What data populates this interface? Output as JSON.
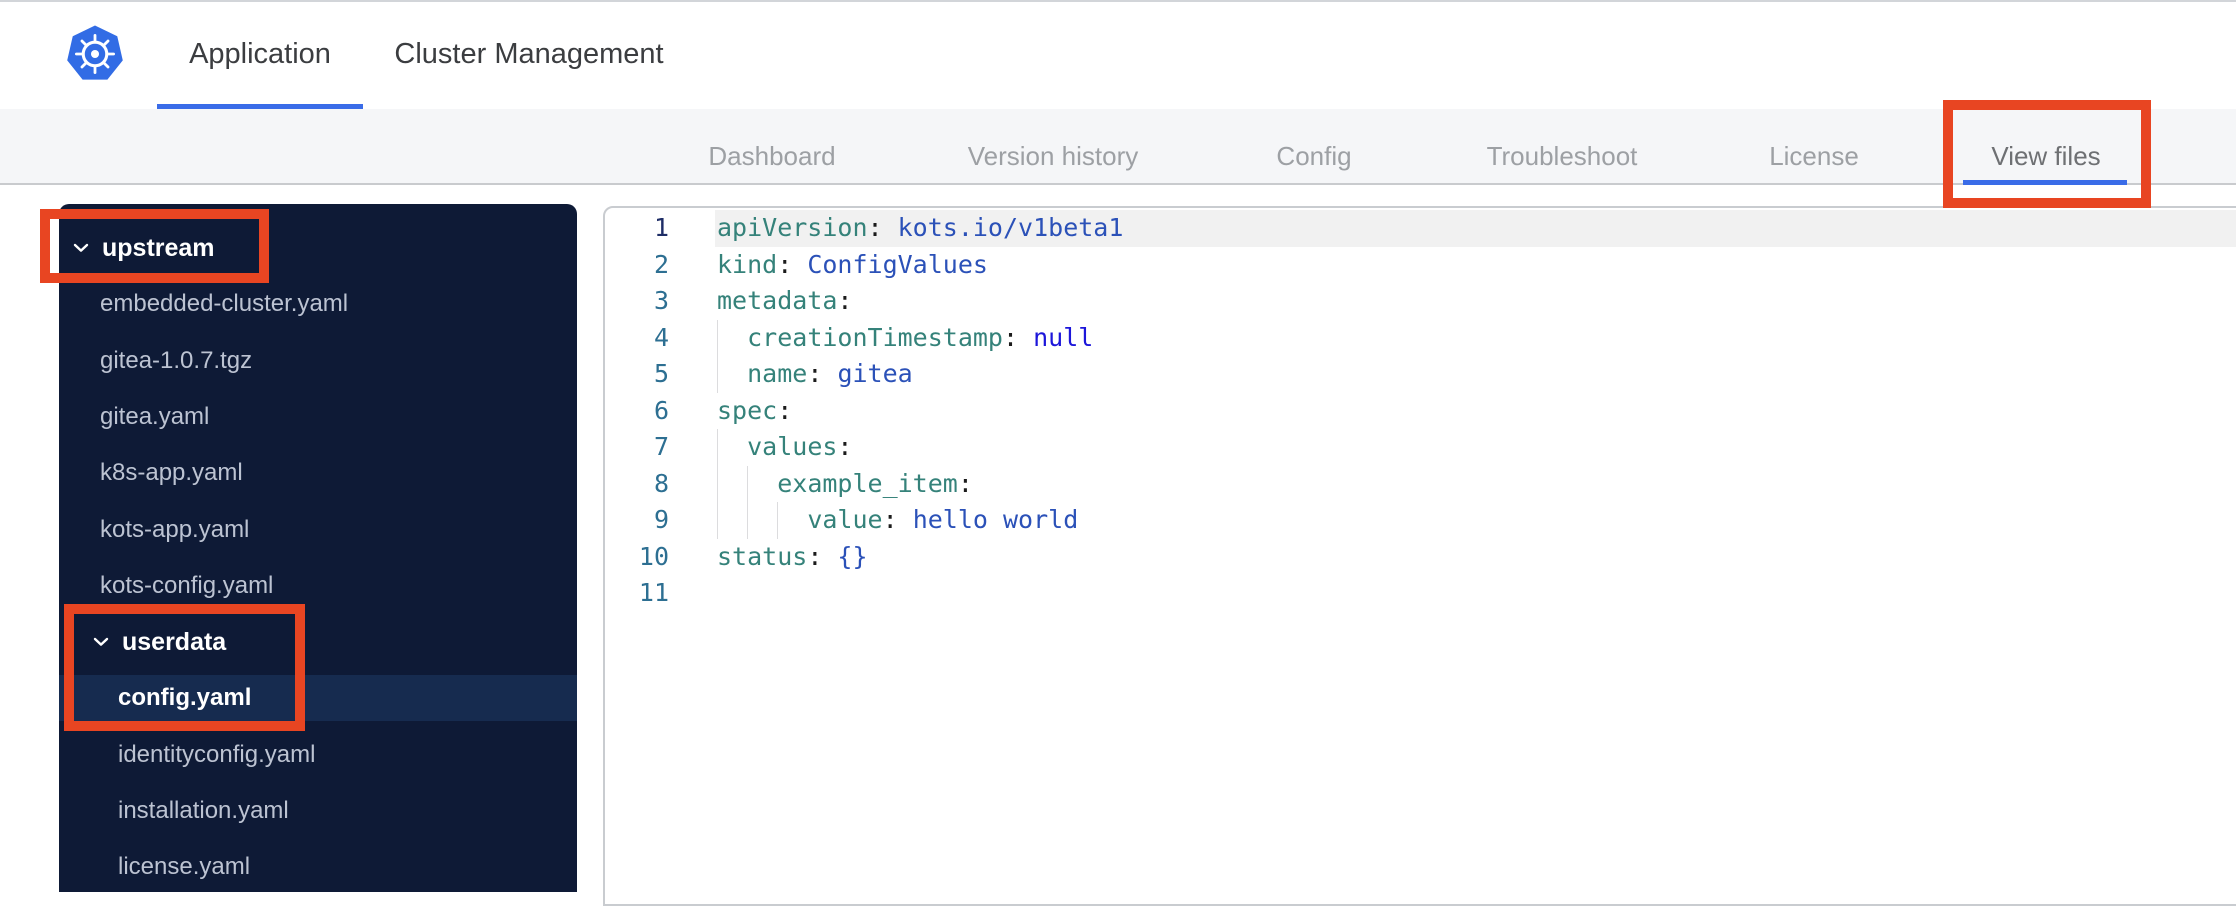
{
  "header": {
    "logo": "kubernetes-logo",
    "tabs": [
      {
        "label": "Application",
        "active": true
      },
      {
        "label": "Cluster Management",
        "active": false
      }
    ]
  },
  "nav": {
    "tabs": [
      {
        "label": "Dashboard",
        "active": false
      },
      {
        "label": "Version history",
        "active": false
      },
      {
        "label": "Config",
        "active": false
      },
      {
        "label": "Troubleshoot",
        "active": false
      },
      {
        "label": "License",
        "active": false
      },
      {
        "label": "View files",
        "active": true,
        "annotated": true
      }
    ]
  },
  "sidebar": {
    "items": [
      {
        "label": "upstream",
        "type": "folder",
        "depth": 0,
        "expanded": true,
        "annotated": true
      },
      {
        "label": "embedded-cluster.yaml",
        "type": "file",
        "depth": 1
      },
      {
        "label": "gitea-1.0.7.tgz",
        "type": "file",
        "depth": 1
      },
      {
        "label": "gitea.yaml",
        "type": "file",
        "depth": 1
      },
      {
        "label": "k8s-app.yaml",
        "type": "file",
        "depth": 1
      },
      {
        "label": "kots-app.yaml",
        "type": "file",
        "depth": 1
      },
      {
        "label": "kots-config.yaml",
        "type": "file",
        "depth": 1
      },
      {
        "label": "userdata",
        "type": "folder",
        "depth": 1,
        "expanded": true,
        "annotated": true
      },
      {
        "label": "config.yaml",
        "type": "file",
        "depth": 2,
        "selected": true,
        "annotated": true
      },
      {
        "label": "identityconfig.yaml",
        "type": "file",
        "depth": 2
      },
      {
        "label": "installation.yaml",
        "type": "file",
        "depth": 2
      },
      {
        "label": "license.yaml",
        "type": "file",
        "depth": 2
      }
    ]
  },
  "editor": {
    "file": "upstream/userdata/config.yaml",
    "lines": [
      {
        "num": "1",
        "indent": 0,
        "active": true,
        "tokens": [
          [
            "key",
            "apiVersion"
          ],
          [
            "punct",
            ": "
          ],
          [
            "val",
            "kots.io/v1beta1"
          ]
        ]
      },
      {
        "num": "2",
        "indent": 0,
        "tokens": [
          [
            "key",
            "kind"
          ],
          [
            "punct",
            ": "
          ],
          [
            "val",
            "ConfigValues"
          ]
        ]
      },
      {
        "num": "3",
        "indent": 0,
        "tokens": [
          [
            "key",
            "metadata"
          ],
          [
            "punct",
            ":"
          ]
        ]
      },
      {
        "num": "4",
        "indent": 2,
        "tokens": [
          [
            "key",
            "creationTimestamp"
          ],
          [
            "punct",
            ": "
          ],
          [
            "atom",
            "null"
          ]
        ]
      },
      {
        "num": "5",
        "indent": 2,
        "tokens": [
          [
            "key",
            "name"
          ],
          [
            "punct",
            ": "
          ],
          [
            "val",
            "gitea"
          ]
        ]
      },
      {
        "num": "6",
        "indent": 0,
        "tokens": [
          [
            "key",
            "spec"
          ],
          [
            "punct",
            ":"
          ]
        ]
      },
      {
        "num": "7",
        "indent": 2,
        "tokens": [
          [
            "key",
            "values"
          ],
          [
            "punct",
            ":"
          ]
        ]
      },
      {
        "num": "8",
        "indent": 4,
        "tokens": [
          [
            "key",
            "example_item"
          ],
          [
            "punct",
            ":"
          ]
        ]
      },
      {
        "num": "9",
        "indent": 6,
        "tokens": [
          [
            "key",
            "value"
          ],
          [
            "punct",
            ": "
          ],
          [
            "val",
            "hello world"
          ]
        ]
      },
      {
        "num": "10",
        "indent": 0,
        "tokens": [
          [
            "key",
            "status"
          ],
          [
            "punct",
            ": "
          ],
          [
            "val",
            "{}"
          ]
        ]
      },
      {
        "num": "11",
        "indent": 0,
        "tokens": []
      }
    ]
  },
  "annotations": [
    {
      "name": "view-files-tab-highlight"
    },
    {
      "name": "upstream-folder-highlight"
    },
    {
      "name": "userdata-config-highlight"
    }
  ],
  "colors": {
    "accent_blue": "#3a6ce8",
    "logo_blue": "#326ce5",
    "annotation_red": "#e84522",
    "sidebar_bg": "#0e1a36",
    "sidebar_selected_bg": "#162b4f",
    "subnav_bg": "#f5f6f8",
    "code_key": "#35827a",
    "code_value": "#2b51b8",
    "code_atom": "#1c16da",
    "line_number": "#2d6f92",
    "active_line_bg": "#f1f1f1"
  }
}
